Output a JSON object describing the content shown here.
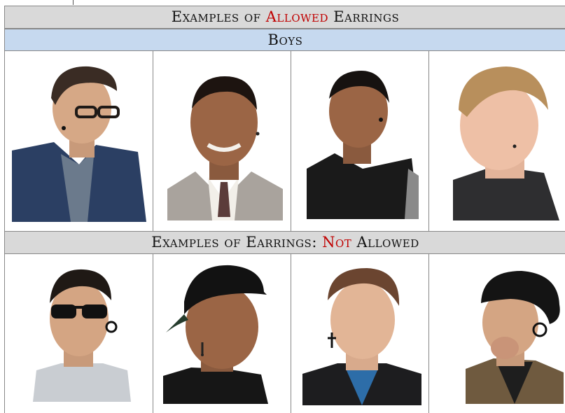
{
  "headers": {
    "allowed_title": {
      "pre": "Examples of ",
      "highlight": "Allowed",
      "post": " Earrings"
    },
    "boys": "Boys",
    "not_allowed_title": {
      "pre": "Examples of Earrings: ",
      "highlight": "Not",
      "post": " Allowed"
    }
  },
  "colors": {
    "header_gray": "#d9d9d9",
    "header_blue": "#c6d9ef",
    "highlight_red": "#c00000"
  },
  "allowed_photos": [
    {
      "icon": "man-glasses-denim-jacket-small-stud-earring"
    },
    {
      "icon": "man-suit-tie-small-stud-earring"
    },
    {
      "icon": "man-black-shirt-stud-earring"
    },
    {
      "icon": "man-blond-profile-stud-earring"
    }
  ],
  "not_allowed_photos": [
    {
      "icon": "man-sunglasses-gauge-earring"
    },
    {
      "icon": "man-backwards-cap-dangling-earring"
    },
    {
      "icon": "man-cross-dangling-earring"
    },
    {
      "icon": "man-beanie-large-gauge-earring"
    }
  ]
}
